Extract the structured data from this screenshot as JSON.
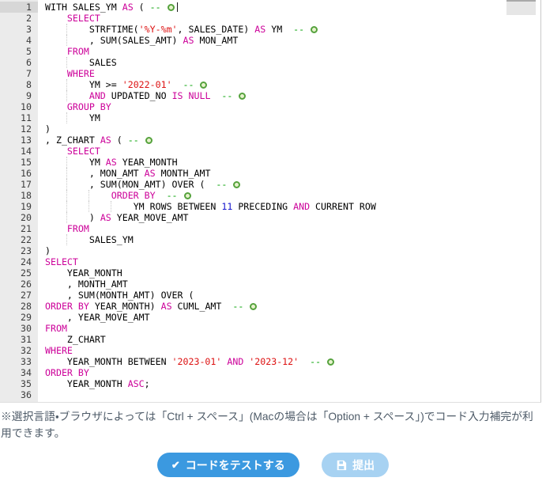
{
  "editor": {
    "active_line": 1,
    "comment_marker_icon": "comment-marker-icon",
    "syntax_colors": {
      "keyword": "#cc0099",
      "string": "#dd1111",
      "number": "#1414cc",
      "comment": "#00a000",
      "plain": "#000000"
    },
    "code_lines": [
      {
        "ind": 0,
        "t": [
          [
            "p",
            "WITH SALES_YM "
          ],
          [
            "k",
            "AS"
          ],
          [
            "p",
            " ( "
          ],
          [
            "c",
            "-- "
          ],
          [
            "i"
          ],
          [
            "u"
          ]
        ]
      },
      {
        "ind": 4,
        "t": [
          [
            "k",
            "SELECT"
          ]
        ]
      },
      {
        "ind": 8,
        "t": [
          [
            "p",
            "STRFTIME("
          ],
          [
            "s",
            "'%Y-%m'"
          ],
          [
            "p",
            ", SALES_DATE) "
          ],
          [
            "k",
            "AS"
          ],
          [
            "p",
            " YM  "
          ],
          [
            "c",
            "-- "
          ],
          [
            "i"
          ]
        ]
      },
      {
        "ind": 8,
        "t": [
          [
            "p",
            ", SUM(SALES_AMT) "
          ],
          [
            "k",
            "AS"
          ],
          [
            "p",
            " MON_AMT"
          ]
        ]
      },
      {
        "ind": 4,
        "t": [
          [
            "k",
            "FROM"
          ]
        ]
      },
      {
        "ind": 8,
        "t": [
          [
            "p",
            "SALES"
          ]
        ]
      },
      {
        "ind": 4,
        "t": [
          [
            "k",
            "WHERE"
          ]
        ]
      },
      {
        "ind": 8,
        "t": [
          [
            "p",
            "YM >= "
          ],
          [
            "s",
            "'2022-01'"
          ],
          [
            "p",
            "  "
          ],
          [
            "c",
            "-- "
          ],
          [
            "i"
          ]
        ]
      },
      {
        "ind": 8,
        "t": [
          [
            "k",
            "AND"
          ],
          [
            "p",
            " UPDATED_NO "
          ],
          [
            "k",
            "IS"
          ],
          [
            "p",
            " "
          ],
          [
            "k",
            "NULL"
          ],
          [
            "p",
            "  "
          ],
          [
            "c",
            "-- "
          ],
          [
            "i"
          ]
        ]
      },
      {
        "ind": 4,
        "t": [
          [
            "k",
            "GROUP BY"
          ]
        ]
      },
      {
        "ind": 8,
        "t": [
          [
            "p",
            "YM"
          ]
        ]
      },
      {
        "ind": 0,
        "t": [
          [
            "p",
            ")"
          ]
        ]
      },
      {
        "ind": 0,
        "t": [
          [
            "p",
            ", Z_CHART "
          ],
          [
            "k",
            "AS"
          ],
          [
            "p",
            " ( "
          ],
          [
            "c",
            "-- "
          ],
          [
            "i"
          ]
        ]
      },
      {
        "ind": 4,
        "t": [
          [
            "k",
            "SELECT"
          ]
        ]
      },
      {
        "ind": 8,
        "t": [
          [
            "p",
            "YM "
          ],
          [
            "k",
            "AS"
          ],
          [
            "p",
            " YEAR_MONTH"
          ]
        ]
      },
      {
        "ind": 8,
        "t": [
          [
            "p",
            ", MON_AMT "
          ],
          [
            "k",
            "AS"
          ],
          [
            "p",
            " MONTH_AMT"
          ]
        ]
      },
      {
        "ind": 8,
        "t": [
          [
            "p",
            ", SUM(MON_AMT) OVER (  "
          ],
          [
            "c",
            "-- "
          ],
          [
            "i"
          ]
        ]
      },
      {
        "ind": 12,
        "t": [
          [
            "k",
            "ORDER BY"
          ],
          [
            "p",
            "  "
          ],
          [
            "c",
            "-- "
          ],
          [
            "i"
          ]
        ]
      },
      {
        "ind": 16,
        "t": [
          [
            "p",
            "YM ROWS BETWEEN "
          ],
          [
            "n",
            "11"
          ],
          [
            "p",
            " PRECEDING "
          ],
          [
            "k",
            "AND"
          ],
          [
            "p",
            " CURRENT ROW"
          ]
        ]
      },
      {
        "ind": 8,
        "t": [
          [
            "p",
            ") "
          ],
          [
            "k",
            "AS"
          ],
          [
            "p",
            " YEAR_MOVE_AMT"
          ]
        ]
      },
      {
        "ind": 4,
        "t": [
          [
            "k",
            "FROM"
          ]
        ]
      },
      {
        "ind": 8,
        "t": [
          [
            "p",
            "SALES_YM"
          ]
        ]
      },
      {
        "ind": 0,
        "t": [
          [
            "p",
            ")"
          ]
        ]
      },
      {
        "ind": 0,
        "t": [
          [
            "k",
            "SELECT"
          ]
        ]
      },
      {
        "ind": 4,
        "t": [
          [
            "p",
            "YEAR_MONTH"
          ]
        ]
      },
      {
        "ind": 4,
        "t": [
          [
            "p",
            ", MONTH_AMT"
          ]
        ]
      },
      {
        "ind": 4,
        "t": [
          [
            "p",
            ", SUM(MONTH_AMT) OVER ("
          ]
        ]
      },
      {
        "ind": 0,
        "t": [
          [
            "k",
            "ORDER BY"
          ],
          [
            "p",
            " YEAR_MONTH) "
          ],
          [
            "k",
            "AS"
          ],
          [
            "p",
            " CUML_AMT  "
          ],
          [
            "c",
            "-- "
          ],
          [
            "i"
          ]
        ]
      },
      {
        "ind": 4,
        "t": [
          [
            "p",
            ", YEAR_MOVE_AMT"
          ]
        ]
      },
      {
        "ind": 0,
        "t": [
          [
            "k",
            "FROM"
          ]
        ]
      },
      {
        "ind": 4,
        "t": [
          [
            "p",
            "Z_CHART"
          ]
        ]
      },
      {
        "ind": 0,
        "t": [
          [
            "k",
            "WHERE"
          ]
        ]
      },
      {
        "ind": 4,
        "t": [
          [
            "p",
            "YEAR_MONTH BETWEEN "
          ],
          [
            "s",
            "'2023-01'"
          ],
          [
            "p",
            " "
          ],
          [
            "k",
            "AND"
          ],
          [
            "p",
            " "
          ],
          [
            "s",
            "'2023-12'"
          ],
          [
            "p",
            "  "
          ],
          [
            "c",
            "-- "
          ],
          [
            "i"
          ]
        ]
      },
      {
        "ind": 0,
        "t": [
          [
            "k",
            "ORDER BY"
          ]
        ]
      },
      {
        "ind": 4,
        "t": [
          [
            "p",
            "YEAR_MONTH "
          ],
          [
            "k",
            "ASC"
          ],
          [
            "p",
            ";"
          ]
        ]
      },
      {
        "ind": 0,
        "t": []
      }
    ]
  },
  "hint": {
    "text": "※選択言語・ブラウザによっては「Ctrl + スペース」(Macの場合は「Option + スペース」)でコード入力補完が利用できます。"
  },
  "actions": {
    "test_button": {
      "label": "コードをテストする",
      "icon": "check-icon",
      "color": "#3b99e0"
    },
    "submit_button": {
      "label": "提出",
      "icon": "save-icon",
      "color": "#a7d2f2"
    }
  }
}
